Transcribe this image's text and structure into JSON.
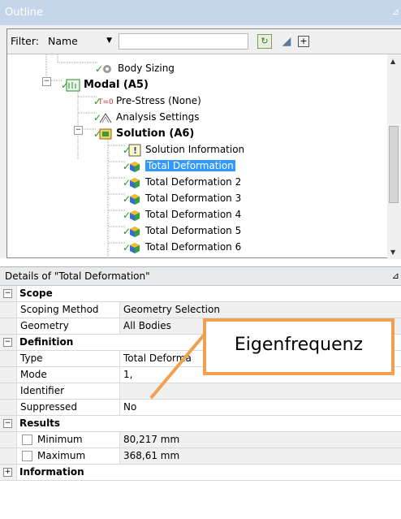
{
  "outline": {
    "title": "Outline",
    "pin_icon": "pin-icon",
    "filter_label": "Filter:",
    "filter_value": "Name",
    "filter_text": "",
    "tree": [
      {
        "label": "Body Sizing",
        "bold": false,
        "selected": false,
        "icon": "body-sizing-icon"
      },
      {
        "label": "Modal (A5)",
        "bold": true,
        "selected": false,
        "icon": "modal-icon"
      },
      {
        "label": "Pre-Stress (None)",
        "bold": false,
        "selected": false,
        "icon": "prestress-icon"
      },
      {
        "label": "Analysis Settings",
        "bold": false,
        "selected": false,
        "icon": "analysis-settings-icon"
      },
      {
        "label": "Solution (A6)",
        "bold": true,
        "selected": false,
        "icon": "solution-icon"
      },
      {
        "label": "Solution Information",
        "bold": false,
        "selected": false,
        "icon": "solution-info-icon"
      },
      {
        "label": "Total Deformation",
        "bold": false,
        "selected": true,
        "icon": "deformation-icon"
      },
      {
        "label": "Total Deformation 2",
        "bold": false,
        "selected": false,
        "icon": "deformation-icon"
      },
      {
        "label": "Total Deformation 3",
        "bold": false,
        "selected": false,
        "icon": "deformation-icon"
      },
      {
        "label": "Total Deformation 4",
        "bold": false,
        "selected": false,
        "icon": "deformation-icon"
      },
      {
        "label": "Total Deformation 5",
        "bold": false,
        "selected": false,
        "icon": "deformation-icon"
      },
      {
        "label": "Total Deformation 6",
        "bold": false,
        "selected": false,
        "icon": "deformation-icon"
      }
    ]
  },
  "details": {
    "title": "Details of \"Total Deformation\"",
    "rows": [
      {
        "kind": "section",
        "label": "Scope",
        "toggle": "−"
      },
      {
        "kind": "prop",
        "key": "Scoping Method",
        "value": "Geometry Selection",
        "shaded": true
      },
      {
        "kind": "prop",
        "key": "Geometry",
        "value": "All Bodies",
        "shaded": true
      },
      {
        "kind": "section",
        "label": "Definition",
        "toggle": "−"
      },
      {
        "kind": "prop",
        "key": "Type",
        "value": "Total Deforma",
        "shaded": false
      },
      {
        "kind": "prop",
        "key": "Mode",
        "value": "1,",
        "shaded": false
      },
      {
        "kind": "prop",
        "key": "Identifier",
        "value": "",
        "shaded": true
      },
      {
        "kind": "prop",
        "key": "Suppressed",
        "value": "No",
        "shaded": false
      },
      {
        "kind": "section",
        "label": "Results",
        "toggle": "−"
      },
      {
        "kind": "result",
        "key": "Minimum",
        "value": "80,217 mm",
        "shaded": true
      },
      {
        "kind": "result",
        "key": "Maximum",
        "value": "368,61 mm",
        "shaded": true
      },
      {
        "kind": "section",
        "label": "Information",
        "toggle": "+"
      }
    ]
  },
  "callout": {
    "text": "Eigenfrequenz",
    "border_color": "#f0a050"
  },
  "colors": {
    "title_bar": "#c6d6ea",
    "selection": "#3399ff",
    "check": "#1a9c1a"
  }
}
